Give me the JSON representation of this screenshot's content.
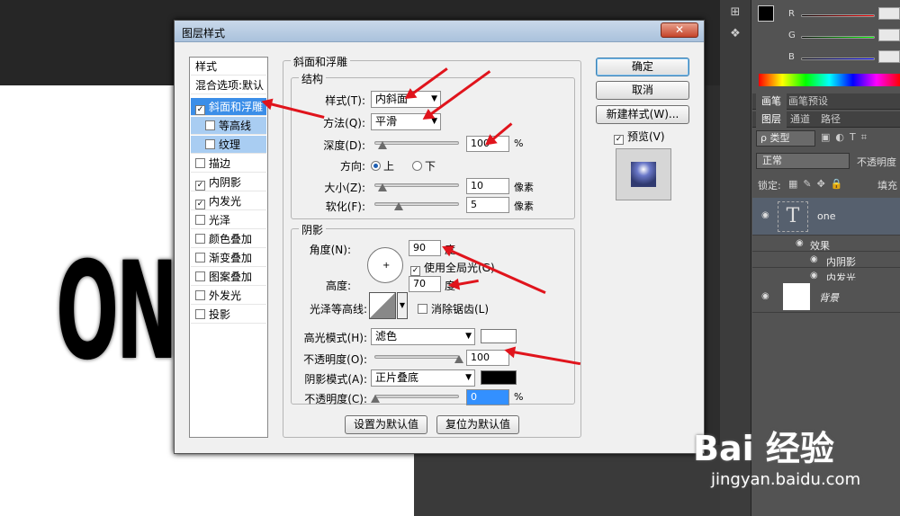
{
  "canvas": {
    "big_text": "ON"
  },
  "dialog": {
    "title": "图层样式",
    "close_glyph": "✕",
    "styles_header": "样式",
    "blend_options": "混合选项:默认",
    "style_items": [
      {
        "label": "斜面和浮雕",
        "checked": true
      },
      {
        "label": "等高线",
        "checked": false
      },
      {
        "label": "纹理",
        "checked": false
      },
      {
        "label": "描边",
        "checked": false
      },
      {
        "label": "内阴影",
        "checked": true
      },
      {
        "label": "内发光",
        "checked": true
      },
      {
        "label": "光泽",
        "checked": false
      },
      {
        "label": "颜色叠加",
        "checked": false
      },
      {
        "label": "渐变叠加",
        "checked": false
      },
      {
        "label": "图案叠加",
        "checked": false
      },
      {
        "label": "外发光",
        "checked": false
      },
      {
        "label": "投影",
        "checked": false
      }
    ],
    "section_title": "斜面和浮雕",
    "structure": {
      "group_label": "结构",
      "style_label": "样式(T):",
      "style_value": "内斜面",
      "technique_label": "方法(Q):",
      "technique_value": "平滑",
      "depth_label": "深度(D):",
      "depth_value": "100",
      "depth_unit": "%",
      "direction_label": "方向:",
      "dir_up": "上",
      "dir_down": "下",
      "size_label": "大小(Z):",
      "size_value": "10",
      "size_unit": "像素",
      "soften_label": "软化(F):",
      "soften_value": "5",
      "soften_unit": "像素"
    },
    "shading": {
      "group_label": "阴影",
      "angle_label": "角度(N):",
      "angle_value": "90",
      "angle_unit": "度",
      "global_light_label": "使用全局光(G)",
      "altitude_label": "高度:",
      "altitude_value": "70",
      "altitude_unit": "度",
      "gloss_contour_label": "光泽等高线:",
      "antialias_label": "消除锯齿(L)",
      "highlight_mode_label": "高光模式(H):",
      "highlight_mode_value": "滤色",
      "highlight_opacity_label": "不透明度(O):",
      "highlight_opacity_value": "100",
      "shadow_mode_label": "阴影模式(A):",
      "shadow_mode_value": "正片叠底",
      "shadow_opacity_label": "不透明度(C):",
      "shadow_opacity_value": "0",
      "shadow_opacity_unit": "%",
      "highlight_color": "#ffffff",
      "shadow_color": "#000000"
    },
    "make_default": "设置为默认值",
    "reset_default": "复位为默认值",
    "ok": "确定",
    "cancel": "取消",
    "new_style": "新建样式(W)...",
    "preview_label": "预览(V)"
  },
  "ps_panel": {
    "color_labels": {
      "r": "R",
      "g": "G",
      "b": "B"
    },
    "tabs_swatches": [
      "画笔",
      "画笔预设"
    ],
    "tabs_layers": [
      "图层",
      "通道",
      "路径"
    ],
    "filter_kind": "ρ 类型",
    "blend_mode": "正常",
    "opacity_label": "不透明度",
    "lock_label": "锁定:",
    "fill_label": "填充",
    "layers": [
      {
        "name": "one",
        "thumb": "T"
      },
      {
        "name": "效果"
      },
      {
        "name": "内阴影"
      },
      {
        "name": "内发光"
      },
      {
        "name": "背景"
      }
    ]
  },
  "watermark": {
    "brand": "Bai  经验",
    "url": "jingyan.baidu.com"
  }
}
